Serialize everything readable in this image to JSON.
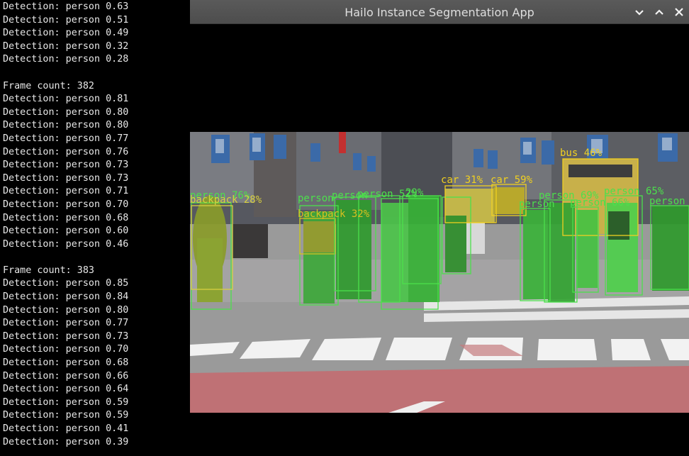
{
  "terminal": {
    "lines": [
      "Detection: person 0.63",
      "Detection: person 0.51",
      "Detection: person 0.49",
      "Detection: person 0.32",
      "Detection: person 0.28",
      "",
      "Frame count: 382",
      "Detection: person 0.81",
      "Detection: person 0.80",
      "Detection: person 0.80",
      "Detection: person 0.77",
      "Detection: person 0.76",
      "Detection: person 0.73",
      "Detection: person 0.73",
      "Detection: person 0.71",
      "Detection: person 0.70",
      "Detection: person 0.68",
      "Detection: person 0.60",
      "Detection: person 0.46",
      "",
      "Frame count: 383",
      "Detection: person 0.85",
      "Detection: person 0.84",
      "Detection: person 0.80",
      "Detection: person 0.77",
      "Detection: person 0.73",
      "Detection: person 0.70",
      "Detection: person 0.68",
      "Detection: person 0.66",
      "Detection: person 0.64",
      "Detection: person 0.59",
      "Detection: person 0.59",
      "Detection: person 0.41",
      "Detection: person 0.39"
    ]
  },
  "window": {
    "title": "Hailo Instance Segmentation App",
    "minimize_glyph": "⌄",
    "maximize_glyph": "⌃",
    "close_glyph": "✕"
  },
  "overlay_labels": {
    "bus": "bus 46%",
    "car1": "car 31%",
    "car2": "car 59%",
    "person_left": "person 76%",
    "backpack_left": "backpack 28%",
    "person_a": "person",
    "person_b": "person",
    "person_c": "person 52%",
    "person_d": "29%",
    "backpack_mid": "backpack 32%",
    "person_e": "person 69%",
    "person_f": "person 66%",
    "person_g": "person 65%",
    "person_h": "person",
    "person_i": "person"
  },
  "colors": {
    "terminal_bg": "#000000",
    "terminal_text": "#e8e8e8",
    "titlebar": "#4f4f4f",
    "title_text": "#dedede",
    "person_box": "#4ce04c",
    "bus_car_box": "#f0d020"
  }
}
